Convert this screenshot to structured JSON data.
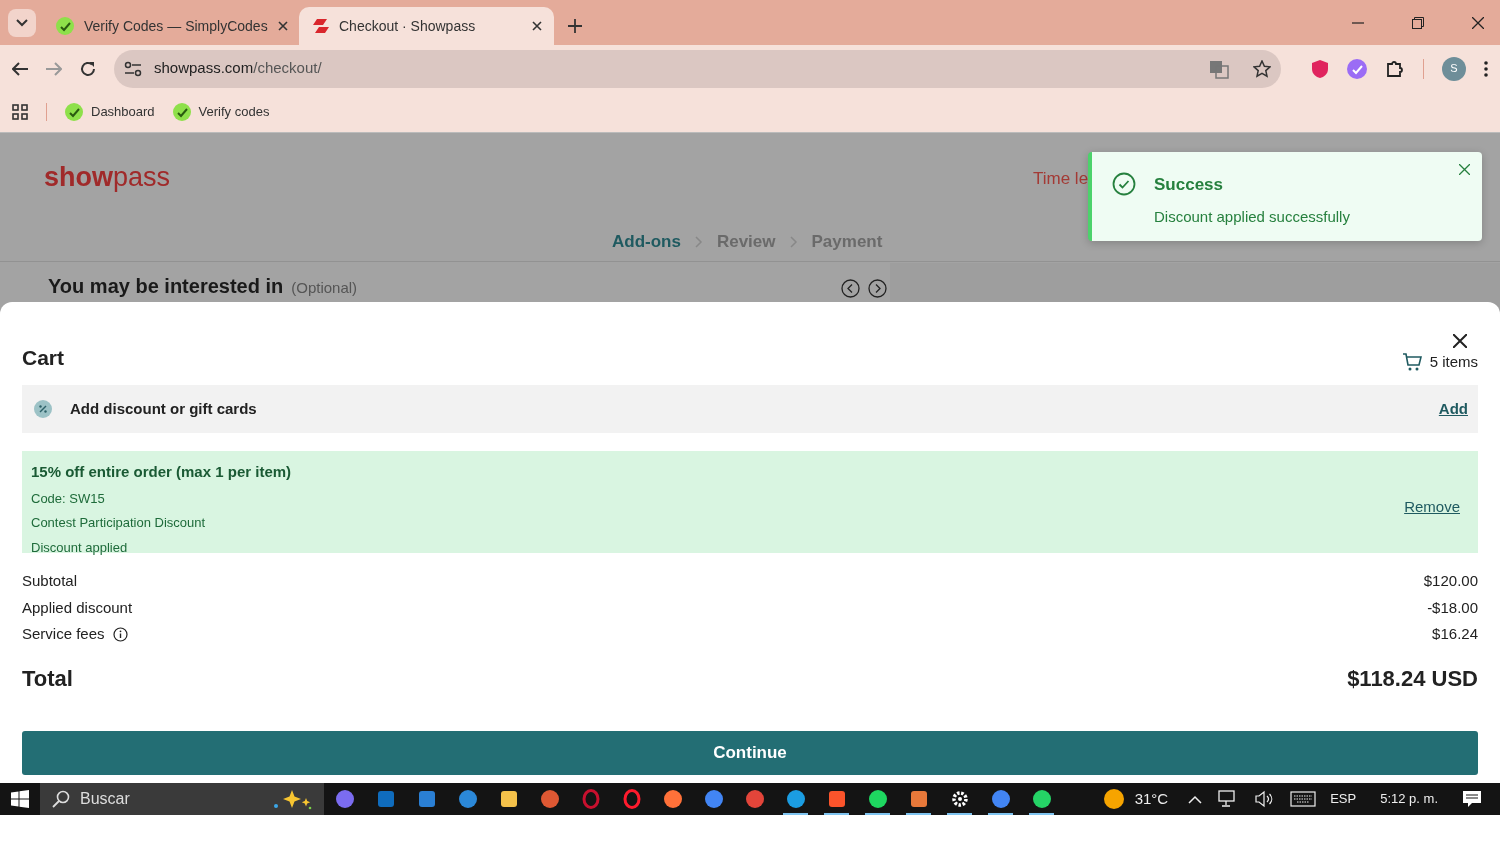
{
  "browser": {
    "tabs": [
      {
        "title": "Verify Codes — SimplyCodes",
        "selected": false,
        "color": "#8ee04a"
      },
      {
        "title": "Checkout · Showpass",
        "selected": true,
        "color": "#d9262c"
      }
    ],
    "url": {
      "host": "showpass.com",
      "path": "/checkout/"
    },
    "bookmarks": [
      "Dashboard",
      "Verify codes"
    ],
    "profile": "S"
  },
  "page": {
    "logo": "**show**pass",
    "timer": "Time le",
    "steps": [
      {
        "label": "Add-ons",
        "selected": true
      },
      {
        "label": "Review",
        "selected": false
      },
      {
        "label": "Payment",
        "selected": false
      }
    ],
    "section_title": "You may be interested in",
    "section_note": "(Optional)"
  },
  "toast": {
    "title": "Success",
    "message": "Discount applied successfully"
  },
  "cart": {
    "title": "Cart",
    "items": "5 items",
    "discount_prompt": "Add discount or gift cards",
    "add": "Add",
    "applied": {
      "title": "15% off entire order (max 1 per item)",
      "lines": [
        "Code: SW15",
        "Contest Participation Discount",
        "Discount applied"
      ],
      "remove": "Remove"
    },
    "summary": [
      {
        "label": "Subtotal",
        "value": "$120.00",
        "info": false
      },
      {
        "label": "Applied discount",
        "value": "-$18.00",
        "info": false
      },
      {
        "label": "Service fees",
        "value": "$16.24",
        "info": true
      }
    ],
    "total": {
      "label": "Total",
      "value": "$118.24 USD"
    },
    "continue": "Continue"
  },
  "taskbar": {
    "search": "Buscar",
    "apps": [
      {
        "kind": "circle",
        "color": "#7b6cf0",
        "running": false
      },
      {
        "kind": "square",
        "color": "#0f6cbd",
        "running": false
      },
      {
        "kind": "square",
        "color": "#2a7fd4",
        "running": false
      },
      {
        "kind": "circle",
        "color": "#2b88d8",
        "running": false
      },
      {
        "kind": "square",
        "color": "#f4c14a",
        "running": false
      },
      {
        "kind": "circle",
        "color": "#de5833",
        "running": false
      },
      {
        "kind": "ring",
        "color": "#c8102e",
        "running": false
      },
      {
        "kind": "ring",
        "color": "#ff1b2d",
        "running": false
      },
      {
        "kind": "circle",
        "color": "#ff7139",
        "running": false
      },
      {
        "kind": "circle",
        "color": "#4285f4",
        "running": false
      },
      {
        "kind": "circle",
        "color": "#e3453a",
        "running": false
      },
      {
        "kind": "circle",
        "color": "#1b9de2",
        "running": true
      },
      {
        "kind": "square",
        "color": "#fb542b",
        "running": true
      },
      {
        "kind": "circle",
        "color": "#1ed760",
        "running": true
      },
      {
        "kind": "square",
        "color": "#e8793a",
        "running": true
      },
      {
        "kind": "gear",
        "color": "#ffffff",
        "running": true
      },
      {
        "kind": "circle",
        "color": "#4285f4",
        "running": true
      },
      {
        "kind": "circle",
        "color": "#25d366",
        "running": true
      }
    ],
    "weather": "31°C",
    "language": "ESP",
    "time": "5:12 p. m."
  }
}
